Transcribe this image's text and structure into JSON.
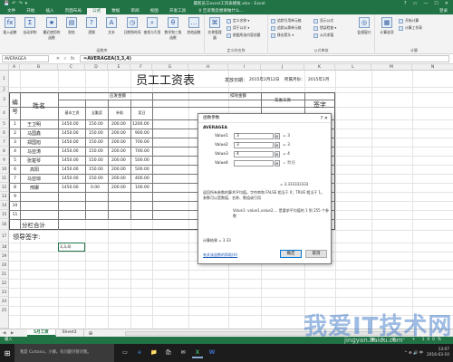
{
  "window": {
    "title": "最新员工excel工资表模板.xlsx - Excel",
    "quick_access": [
      "💾",
      "↶",
      "↷",
      "▾"
    ],
    "controls": [
      "?",
      "▭",
      "—",
      "☐",
      "✕"
    ]
  },
  "ribbon": {
    "tabs": [
      "文件",
      "开始",
      "插入",
      "页面布局",
      "公式",
      "数据",
      "审阅",
      "视图",
      "开发工具"
    ],
    "active_tab": "公式",
    "tell_me": "♀ 告诉我您想要做什么...",
    "login": "登录",
    "groups": {
      "library": {
        "label": "函数库",
        "big_buttons": [
          "插入函数",
          "自动求和",
          "最近使用的函数",
          "财务",
          "逻辑",
          "文本",
          "日期和时间",
          "查找与引用",
          "数学和三角函数",
          "其他函数"
        ]
      },
      "names": {
        "label": "定义的名称",
        "big_button": "名称管理器",
        "small_buttons": [
          "定义名称 ▾",
          "用于公式 ▾",
          "根据所选内容创建"
        ]
      },
      "audit": {
        "label": "公式审核",
        "small_buttons": [
          "追踪引用单元格",
          "追踪从属单元格",
          "移去箭头 ▾",
          "显示公式",
          "错误检查 ▾",
          "公式求值"
        ],
        "big_button": "监视窗口"
      },
      "calc": {
        "label": "计算",
        "big_button": "计算选项",
        "small_buttons": [
          "开始计算",
          "计算工作表"
        ]
      }
    }
  },
  "formula_bar": {
    "name_box": "AVERAGEA",
    "cancel": "✕",
    "enter": "✓",
    "fx": "fx",
    "formula": "=AVERAGEA(3,3,4)"
  },
  "grid": {
    "columns": [
      "A",
      "B",
      "C",
      "D",
      "E",
      "F",
      "G",
      "H",
      "I",
      "J",
      "K",
      "L",
      "M",
      "N"
    ],
    "rows": [
      "1",
      "2",
      "3",
      "4",
      "5",
      "6",
      "7",
      "8",
      "9",
      "10",
      "11",
      "12",
      "13",
      "14",
      "15",
      "16",
      "17",
      "18",
      "19",
      "20",
      "21",
      "22",
      "23",
      "24",
      "25"
    ],
    "title": "员工工资表",
    "issue_date_label": "发放日期：",
    "issue_date": "2015年2月12日",
    "month_label": "所属月份：",
    "month": "2015年1月",
    "header_no": "编号",
    "header_name": "姓名",
    "header_due": "应发金额",
    "header_deduct": "扣除金额",
    "header_actual": "实发工资",
    "header_sign": "签字",
    "sub_headers": [
      "基本工资",
      "全勤奖",
      "补助",
      "奖日",
      "函数参数"
    ],
    "employees": [
      {
        "no": "1",
        "name": "王卫明",
        "base": "1450.00",
        "bonus": "150.00",
        "sub": "200.00",
        "extra": "1200.00"
      },
      {
        "no": "2",
        "name": "马国鑫",
        "base": "1450.00",
        "bonus": "150.00",
        "sub": "200.00",
        "extra": "900.00"
      },
      {
        "no": "3",
        "name": "郑国旭",
        "base": "1450.00",
        "bonus": "150.00",
        "sub": "200.00",
        "extra": "700.00"
      },
      {
        "no": "4",
        "name": "马亚涛",
        "base": "1450.00",
        "bonus": "150.00",
        "sub": "200.00",
        "extra": "700.00"
      },
      {
        "no": "5",
        "name": "张楚琴",
        "base": "1450.00",
        "bonus": "150.00",
        "sub": "200.00",
        "extra": "500.00"
      },
      {
        "no": "6",
        "name": "高阳",
        "base": "1450.00",
        "bonus": "150.00",
        "sub": "200.00",
        "extra": "500.00"
      },
      {
        "no": "7",
        "name": "马亚琼",
        "base": "1450.00",
        "bonus": "150.00",
        "sub": "200.00",
        "extra": "400.00"
      },
      {
        "no": "8",
        "name": "邢娜",
        "base": "1450.00",
        "bonus": "0.00",
        "sub": "200.00",
        "extra": "100.00"
      },
      {
        "no": "9",
        "name": "",
        "base": "",
        "bonus": "",
        "sub": "",
        "extra": ""
      },
      {
        "no": "10",
        "name": "",
        "base": "",
        "bonus": "",
        "sub": "",
        "extra": ""
      },
      {
        "no": "11",
        "name": "",
        "base": "",
        "bonus": "",
        "sub": "",
        "extra": ""
      }
    ],
    "subtotal": "分栏合计",
    "leader_sign": "领导签字:",
    "editing_cell": "3,3,4)"
  },
  "dialog": {
    "title": "函数参数",
    "close": "?  ✕",
    "function_name": "AVERAGEA",
    "args": [
      {
        "label": "Value1",
        "value": "3",
        "result": "= 3"
      },
      {
        "label": "Value2",
        "value": "3",
        "result": "= 3"
      },
      {
        "label": "Value3",
        "value": "4",
        "result": "= 4"
      },
      {
        "label": "Value4",
        "value": "",
        "result": "= 数值"
      }
    ],
    "total_result": "= 3.333333333",
    "description": "返回所有参数的算术平均值。字符串和 FALSE 相当于 0；TRUE 相当于 1。参数可以是数值、名称、数组或引用",
    "arg_help": "Value1: value1,value2,... 是要求平均值的 1 到 255 个参数",
    "calc_result": "计算结果 = 3.33",
    "help_link": "有关该函数的帮助(H)",
    "ok": "确定",
    "cancel": "取消"
  },
  "sheets": {
    "nav": "◀ ▶",
    "tabs": [
      "5月工资",
      "Sheet3"
    ],
    "active": "5月工资",
    "add": "⊕"
  },
  "status": {
    "mode": "输入",
    "right": "▦ ▭ ▤ − + 100%"
  },
  "taskbar": {
    "search": "我是 Cortana，小娜。有问题尽管问我。",
    "apps": [
      "▭",
      "e",
      "📁",
      "🛍",
      "✉",
      "X",
      "W"
    ],
    "tray": "^ ⊕ 🔊 中",
    "time": "13:07",
    "date": "2016-03-10"
  },
  "watermark": {
    "main": "我爱IT技术网",
    "sub": "jingyan.baidu.com"
  }
}
